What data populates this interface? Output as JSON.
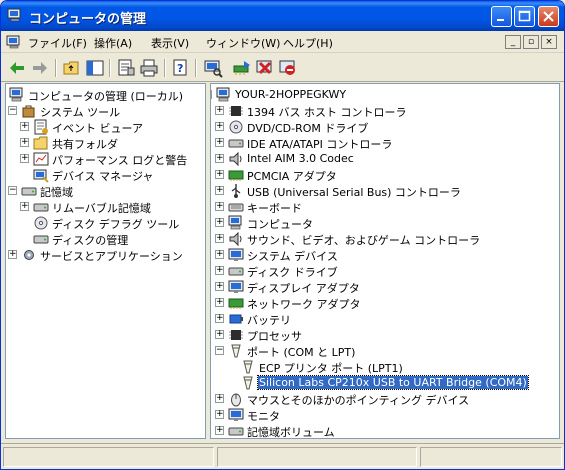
{
  "window": {
    "title": "コンピュータの管理"
  },
  "menu": {
    "items": [
      "ファイル(F)",
      "操作(A)",
      "表示(V)",
      "ウィンドウ(W)",
      "ヘルプ(H)"
    ]
  },
  "toolbar": {
    "icons": [
      "back-arrow-icon",
      "forward-arrow-icon",
      "up-folder-icon",
      "show-hide-tree-icon",
      "properties-icon",
      "print-icon",
      "help-icon",
      "scan-hardware-icon",
      "update-driver-icon",
      "uninstall-icon",
      "disable-icon"
    ]
  },
  "left_tree": [
    {
      "label": "コンピュータの管理 (ローカル)",
      "icon": "computer-management-icon",
      "level": 0,
      "expander": ""
    },
    {
      "label": "システム ツール",
      "icon": "system-tools-icon",
      "level": 1,
      "expander": "-"
    },
    {
      "label": "イベント ビューア",
      "icon": "event-viewer-icon",
      "level": 2,
      "expander": "+"
    },
    {
      "label": "共有フォルダ",
      "icon": "shared-folder-icon",
      "level": 2,
      "expander": "+"
    },
    {
      "label": "パフォーマンス ログと警告",
      "icon": "performance-icon",
      "level": 2,
      "expander": "+"
    },
    {
      "label": "デバイス マネージャ",
      "icon": "device-manager-icon",
      "level": 2,
      "expander": ""
    },
    {
      "label": "記憶域",
      "icon": "storage-icon",
      "level": 1,
      "expander": "-"
    },
    {
      "label": "リムーバブル記憶域",
      "icon": "removable-storage-icon",
      "level": 2,
      "expander": "+"
    },
    {
      "label": "ディスク デフラグ ツール",
      "icon": "defrag-icon",
      "level": 2,
      "expander": ""
    },
    {
      "label": "ディスクの管理",
      "icon": "disk-management-icon",
      "level": 2,
      "expander": ""
    },
    {
      "label": "サービスとアプリケーション",
      "icon": "services-icon",
      "level": 1,
      "expander": "+"
    }
  ],
  "right_tree": [
    {
      "label": "YOUR-2HOPPEGKWY",
      "icon": "computer-icon",
      "level": 0,
      "expander": "-"
    },
    {
      "label": "1394 バス ホスト コントローラ",
      "icon": "bus-controller-icon",
      "level": 1,
      "expander": "+"
    },
    {
      "label": "DVD/CD-ROM ドライブ",
      "icon": "cdrom-icon",
      "level": 1,
      "expander": "+"
    },
    {
      "label": "IDE ATA/ATAPI コントローラ",
      "icon": "ide-controller-icon",
      "level": 1,
      "expander": "+"
    },
    {
      "label": "Intel AIM 3.0 Codec",
      "icon": "codec-icon",
      "level": 1,
      "expander": "+"
    },
    {
      "label": "PCMCIA アダプタ",
      "icon": "pcmcia-icon",
      "level": 1,
      "expander": "+"
    },
    {
      "label": "USB (Universal Serial Bus) コントローラ",
      "icon": "usb-icon",
      "level": 1,
      "expander": "+"
    },
    {
      "label": "キーボード",
      "icon": "keyboard-icon",
      "level": 1,
      "expander": "+"
    },
    {
      "label": "コンピュータ",
      "icon": "computer-icon",
      "level": 1,
      "expander": "+"
    },
    {
      "label": "サウンド、ビデオ、およびゲーム コントローラ",
      "icon": "sound-icon",
      "level": 1,
      "expander": "+"
    },
    {
      "label": "システム デバイス",
      "icon": "system-device-icon",
      "level": 1,
      "expander": "+"
    },
    {
      "label": "ディスク ドライブ",
      "icon": "disk-drive-icon",
      "level": 1,
      "expander": "+"
    },
    {
      "label": "ディスプレイ アダプタ",
      "icon": "display-adapter-icon",
      "level": 1,
      "expander": "+"
    },
    {
      "label": "ネットワーク アダプタ",
      "icon": "network-adapter-icon",
      "level": 1,
      "expander": "+"
    },
    {
      "label": "バッテリ",
      "icon": "battery-icon",
      "level": 1,
      "expander": "+"
    },
    {
      "label": "プロセッサ",
      "icon": "processor-icon",
      "level": 1,
      "expander": "+"
    },
    {
      "label": "ポート (COM と LPT)",
      "icon": "port-icon",
      "level": 1,
      "expander": "-"
    },
    {
      "label": "ECP プリンタ ポート (LPT1)",
      "icon": "port-icon",
      "level": 2,
      "expander": ""
    },
    {
      "label": "Silicon Labs CP210x USB to UART Bridge (COM4)",
      "icon": "port-icon",
      "level": 2,
      "expander": "",
      "selected": true
    },
    {
      "label": "マウスとそのほかのポインティング デバイス",
      "icon": "mouse-icon",
      "level": 1,
      "expander": "+"
    },
    {
      "label": "モニタ",
      "icon": "monitor-icon",
      "level": 1,
      "expander": "+"
    },
    {
      "label": "記憶域ボリューム",
      "icon": "storage-volume-icon",
      "level": 1,
      "expander": "+"
    }
  ],
  "colors": {
    "titlebar": "#0055e5",
    "selection": "#316ac5",
    "window_bg": "#ece9d8"
  }
}
